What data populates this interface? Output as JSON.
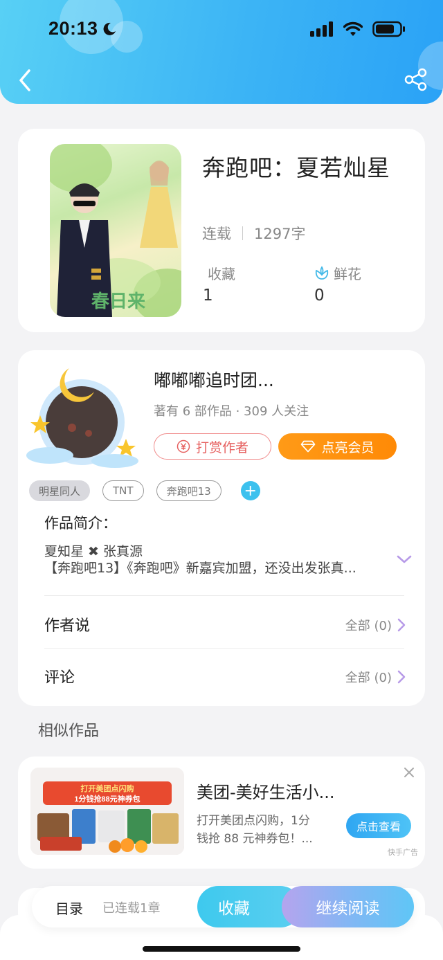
{
  "status_bar": {
    "time": "20:13"
  },
  "book": {
    "title": "奔跑吧：夏若灿星",
    "status": "连载",
    "word_count": "1297字",
    "favorites_label": "收藏",
    "favorites_count": "1",
    "flowers_label": "鲜花",
    "flowers_count": "0",
    "cover_caption": "春日来"
  },
  "author": {
    "name": "嘟嘟嘟追时团...",
    "summary": "著有 6 部作品 · 309 人关注",
    "reward_label": "打赏作者",
    "vip_label": "点亮会员",
    "tags": [
      "明星同人",
      "TNT",
      "奔跑吧13"
    ],
    "tag_add": "+"
  },
  "intro": {
    "title": "作品简介：",
    "line1": "夏知星 ✖ 张真源",
    "line2": "【奔跑吧13】《奔跑吧》新嘉宾加盟，还没出发张真..."
  },
  "author_says": {
    "label": "作者说",
    "value": "全部 (0)"
  },
  "comments": {
    "label": "评论",
    "value": "全部 (0)"
  },
  "similar": {
    "title": "相似作品"
  },
  "ad": {
    "title": "美团-美好生活小...",
    "desc_line1": "打开美团点闪购，1分",
    "desc_line2": "钱抢 88 元神券包！...",
    "button": "点击查看",
    "source": "快手广告",
    "banner_line1": "打开美团点闪购",
    "banner_line2": "1分钱抢88元神券包"
  },
  "bottom_bar": {
    "toc": "目录",
    "chapters": "已连载1章",
    "favorite": "收藏",
    "read": "继续阅读"
  },
  "colors": {
    "header": "#3cb4f5",
    "accent_orange": "#ff9a17",
    "reward_red": "#e6605f",
    "chevron_purple": "#b79ae8"
  }
}
